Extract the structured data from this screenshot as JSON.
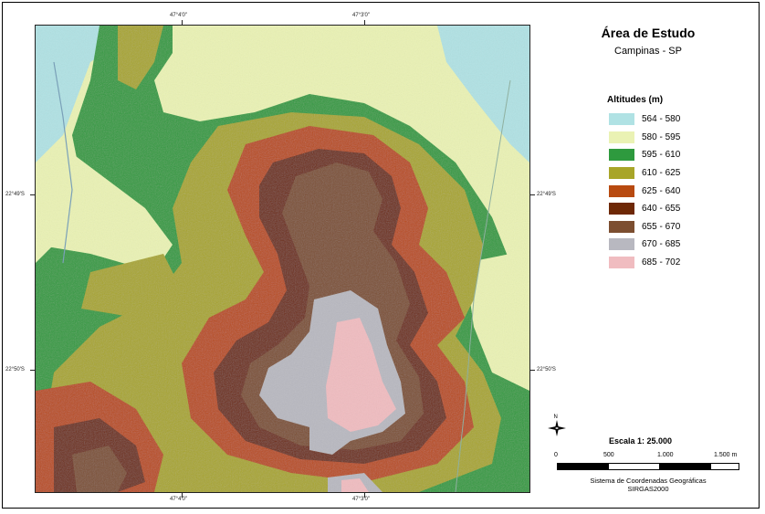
{
  "title": "Área de Estudo",
  "subtitle": "Campinas - SP",
  "legend": {
    "title": "Altitudes (m)",
    "items": [
      {
        "label": "564 - 580",
        "color": "#b0e2e4"
      },
      {
        "label": "580 - 595",
        "color": "#eaf2b4"
      },
      {
        "label": "595 - 610",
        "color": "#2e9a3e"
      },
      {
        "label": "610 - 625",
        "color": "#a8a528"
      },
      {
        "label": "625 - 640",
        "color": "#b84a10"
      },
      {
        "label": "640 - 655",
        "color": "#6e2806"
      },
      {
        "label": "655 - 670",
        "color": "#7c4e30"
      },
      {
        "label": "670 - 685",
        "color": "#b8b8c0"
      },
      {
        "label": "685 - 702",
        "color": "#f0bcc0"
      }
    ]
  },
  "coordinates": {
    "top": [
      "47°4'0\"",
      "47°3'0\""
    ],
    "bottom": [
      "47°4'0\"",
      "47°3'0\""
    ],
    "left": [
      "22°49'S",
      "22°50'S"
    ],
    "right": [
      "22°49'S",
      "22°50'S"
    ]
  },
  "scale": {
    "title": "Escala 1: 25.000",
    "ticks": [
      "0",
      "500",
      "1.000",
      "1.500 m"
    ]
  },
  "crs": {
    "line1": "Sistema de Coordenadas Geográficas",
    "line2": "SIRGAS2000"
  },
  "north_arrow": {
    "label": "N",
    "icon": "north-arrow-icon"
  }
}
